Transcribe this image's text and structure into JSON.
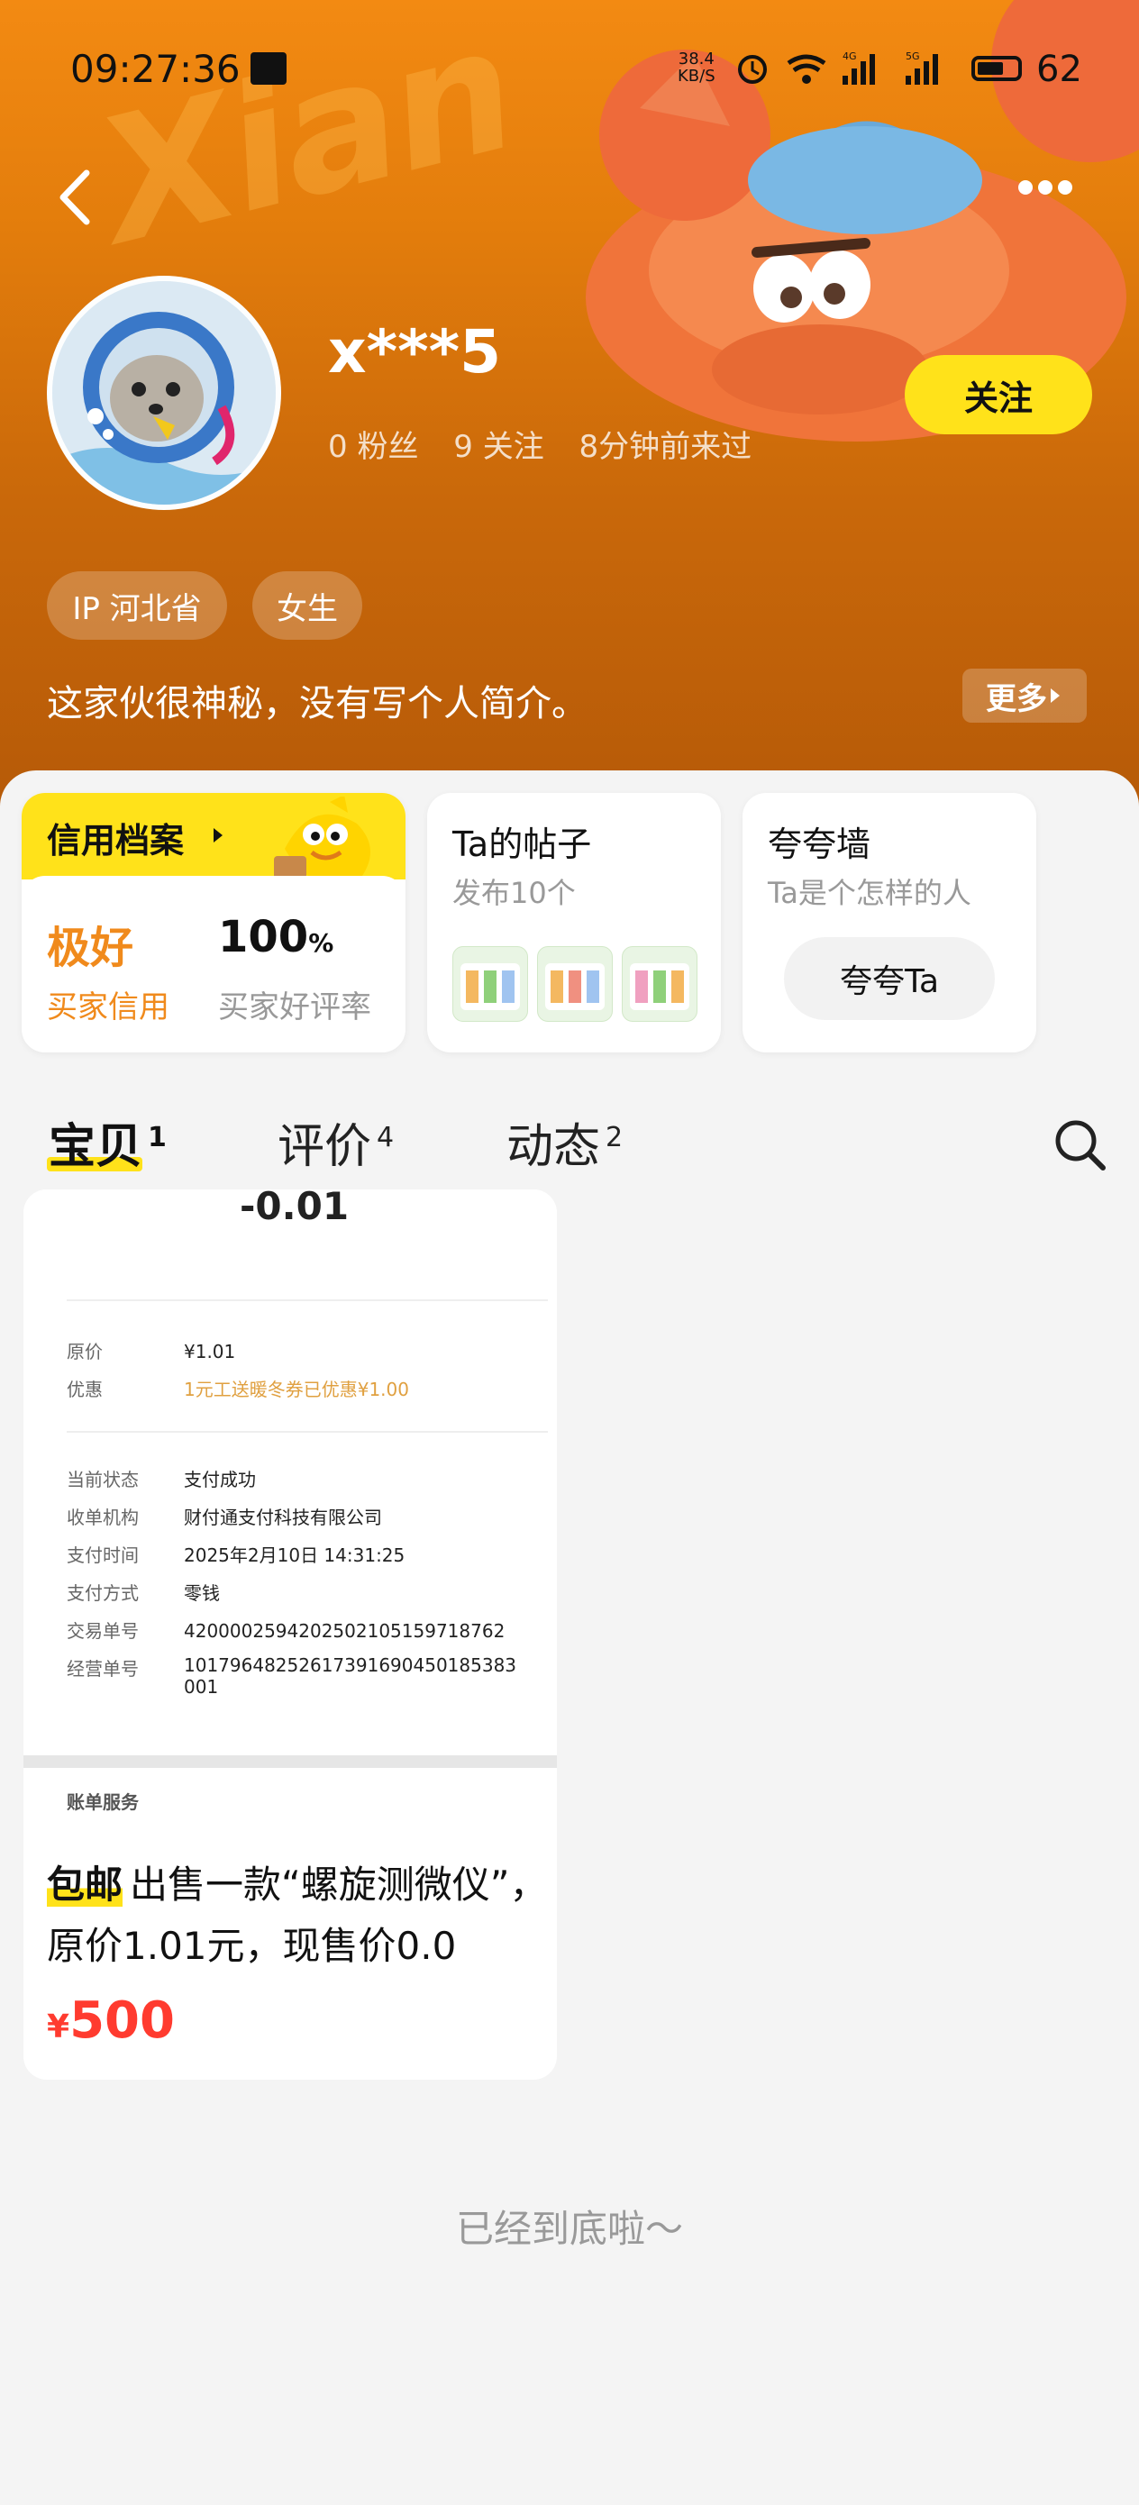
{
  "status_bar": {
    "time": "09:27:36",
    "net_speed_value": "38.4",
    "net_speed_unit": "KB/S",
    "signal_1_label": "4G",
    "signal_2_label": "5G",
    "battery_level": "62"
  },
  "profile": {
    "username": "x***5",
    "fans": "0 粉丝",
    "following": "9 关注",
    "last_seen": "8分钟前来过",
    "follow_label": "关注",
    "tags": [
      "IP 河北省",
      "女生"
    ],
    "bio": "这家伙很神秘，没有写个人简介。",
    "more_label": "更多"
  },
  "credit": {
    "title": "信用档案",
    "rating": "极好",
    "rating_label": "买家信用",
    "good_rate": "100",
    "good_rate_unit": "%",
    "good_rate_label": "买家好评率"
  },
  "posts": {
    "title": "Ta的帖子",
    "subtitle": "发布10个"
  },
  "kuakua": {
    "title": "夸夸墙",
    "subtitle": "Ta是个怎样的人",
    "button_label": "夸夸Ta"
  },
  "tabs": [
    {
      "label": "宝贝",
      "count": "1"
    },
    {
      "label": "评价",
      "count": "4"
    },
    {
      "label": "动态",
      "count": "2"
    }
  ],
  "item": {
    "receipt": {
      "amount": "-0.01",
      "rows": [
        {
          "key": "原价",
          "value": "¥1.01"
        },
        {
          "key": "优惠",
          "value": "1元工送暖冬券已优惠¥1.00"
        },
        {
          "key": "当前状态",
          "value": "支付成功"
        },
        {
          "key": "收单机构",
          "value": "财付通支付科技有限公司"
        },
        {
          "key": "支付时间",
          "value": "2025年2月10日 14:31:25"
        },
        {
          "key": "支付方式",
          "value": "零钱"
        },
        {
          "key": "交易单号",
          "value": "4200002594202502105159718762"
        },
        {
          "key": "经营单号",
          "value": "10179648252617391690450185383001"
        }
      ],
      "service_label": "账单服务"
    },
    "badge": "包邮",
    "title": "出售一款“螺旋测微仪”，原价1.01元，现售价0.0",
    "currency": "¥",
    "price": "500"
  },
  "footer": {
    "end_text": "已经到底啦～"
  },
  "colors": {
    "brand_yellow": "#ffe21a",
    "header_orange": "#e37d0c",
    "price_red": "#ff3b2f",
    "credit_orange": "#f08a1c"
  }
}
